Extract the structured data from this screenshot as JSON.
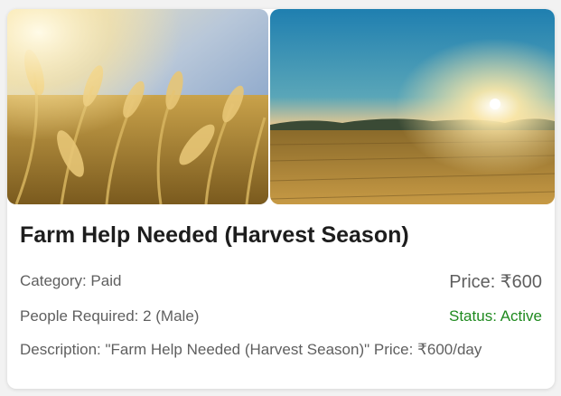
{
  "listing": {
    "title": "Farm Help Needed (Harvest Season)",
    "category": "Category: Paid",
    "price": "Price: ₹600",
    "people_required": "People Required: 2 (Male)",
    "status": "Status: Active",
    "description": "Description: \"Farm Help Needed (Harvest Season)\" Price: ₹600/day",
    "status_color": "#1f8a1f"
  },
  "images": [
    {
      "name": "wheat-closeup-photo"
    },
    {
      "name": "field-sunset-photo"
    }
  ]
}
